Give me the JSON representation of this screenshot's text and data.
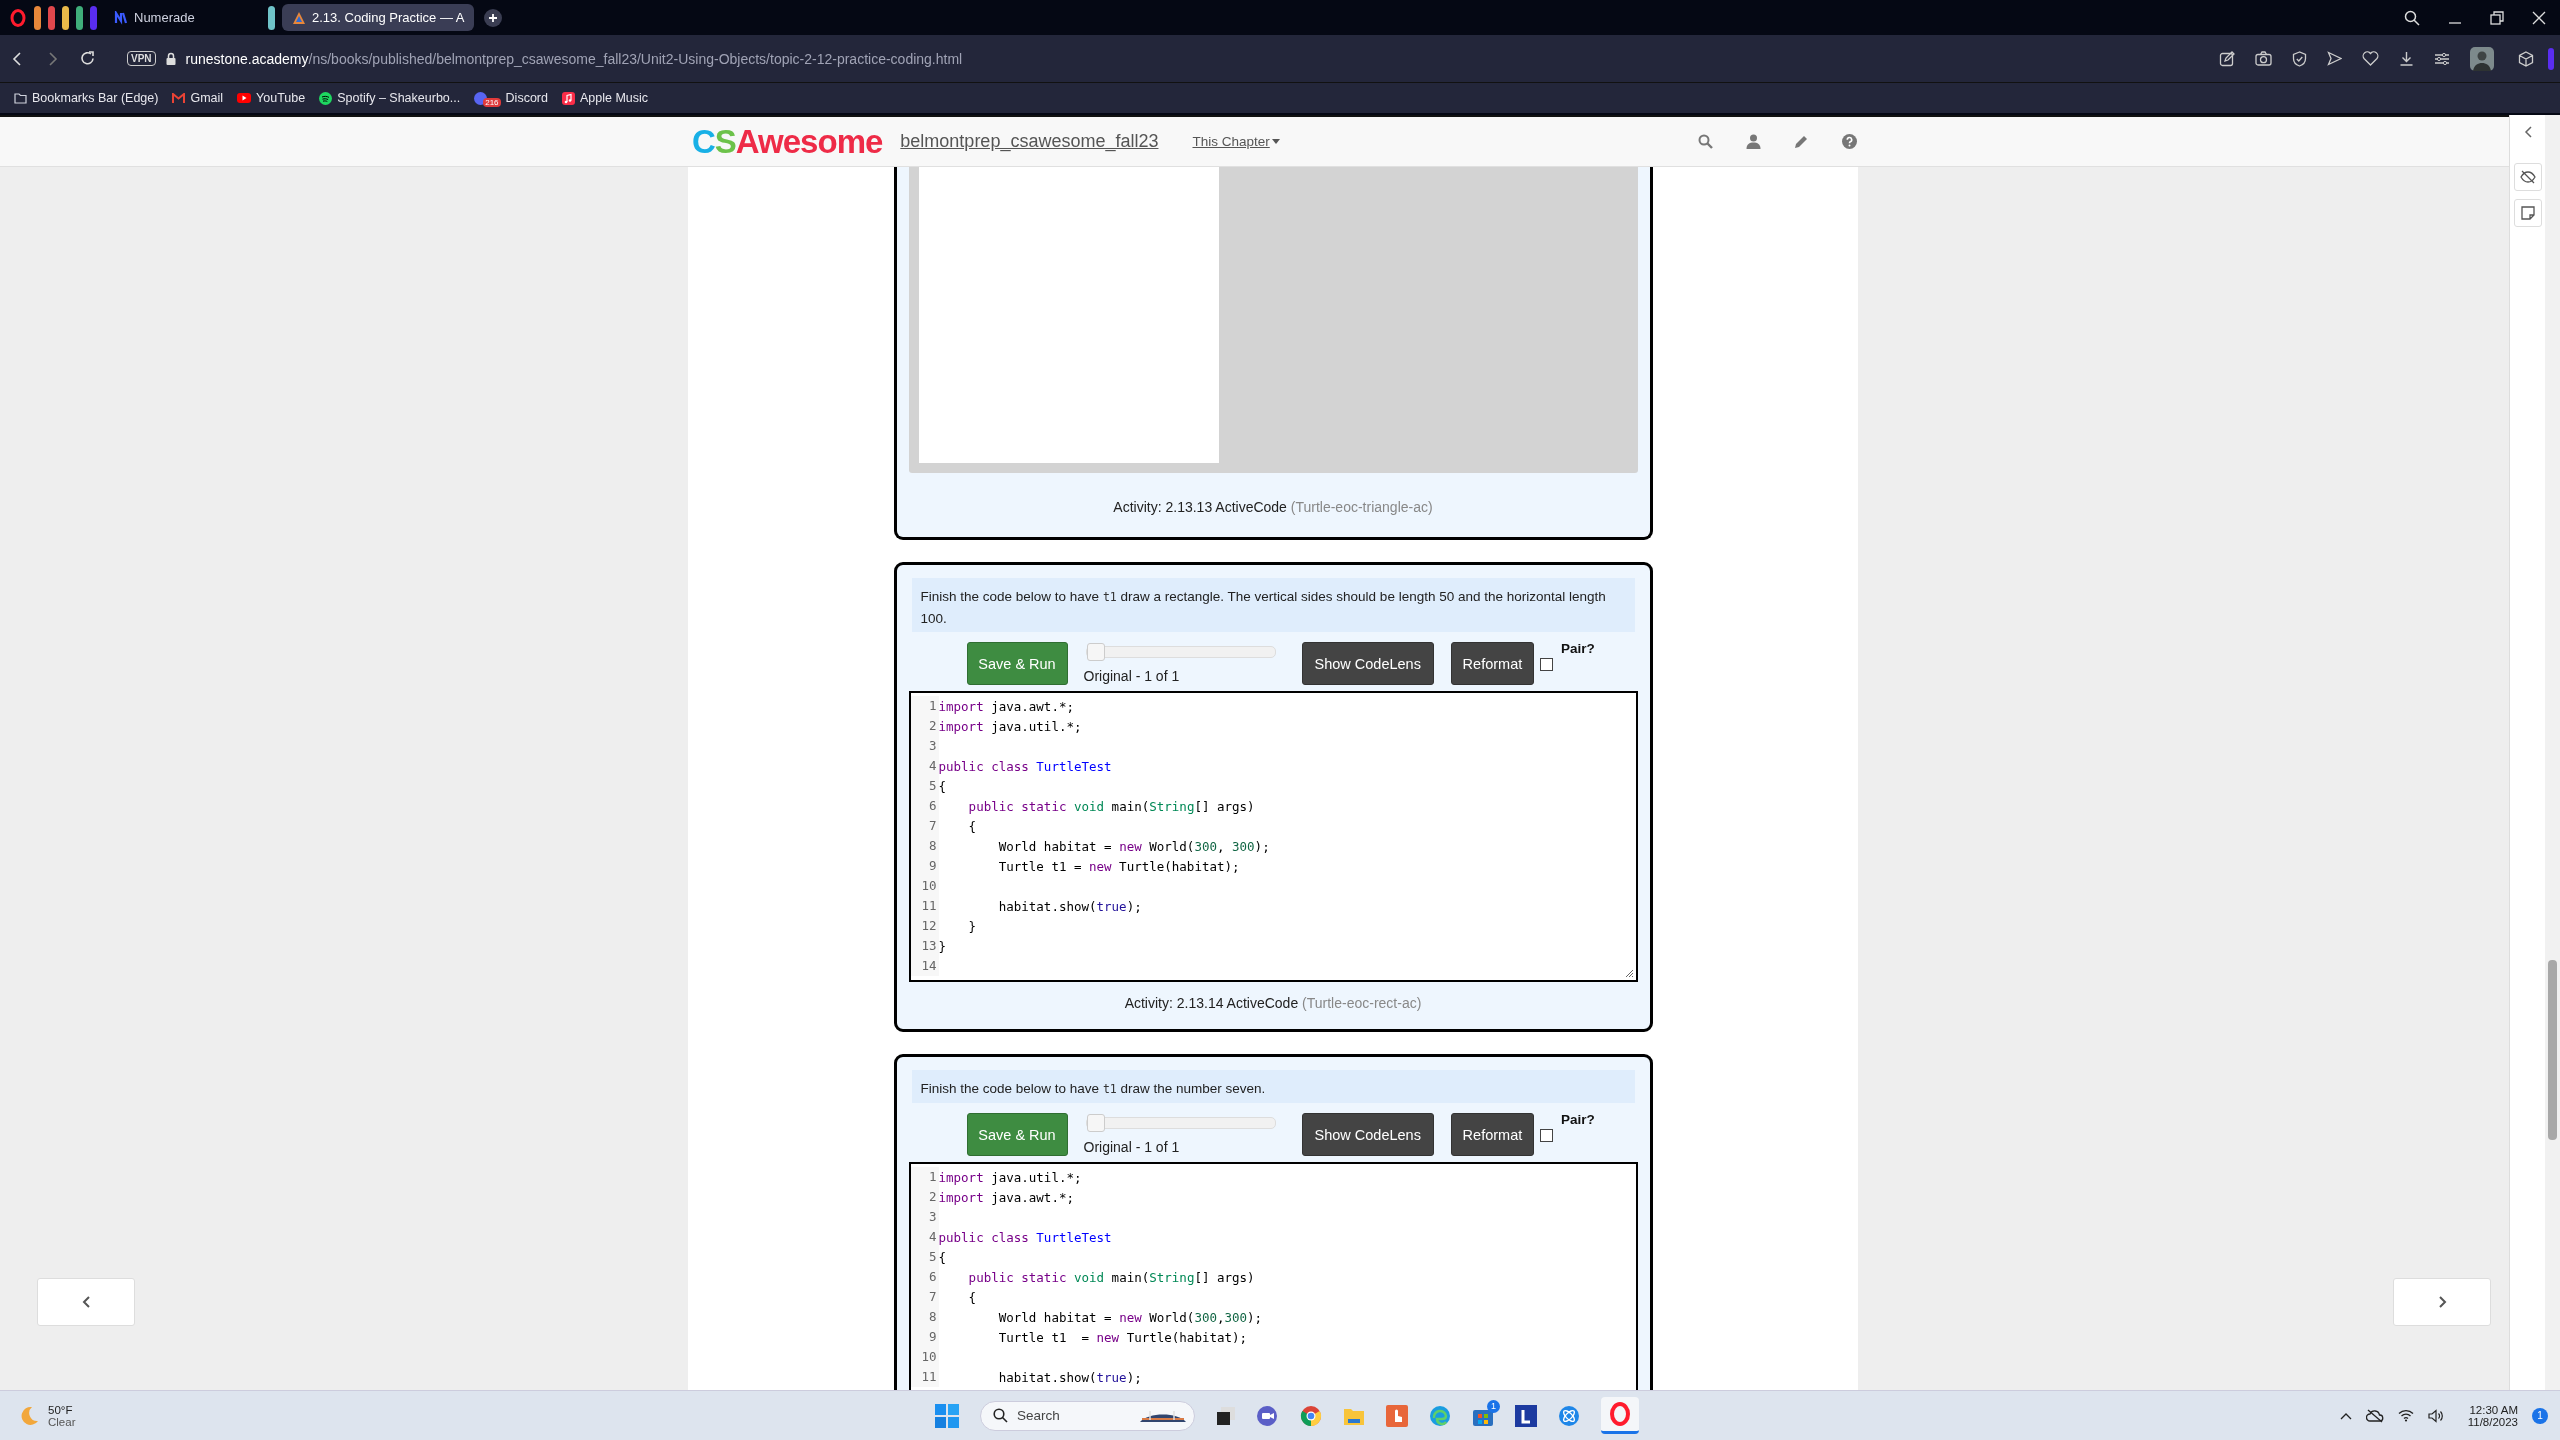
{
  "browser": {
    "workspaces": [
      {
        "color": "#e8873a"
      },
      {
        "color": "#e0474c"
      },
      {
        "color": "#e9b949"
      },
      {
        "color": "#3fae7a"
      },
      {
        "color": "#5a2df0"
      }
    ],
    "tab_pin": {
      "color": "#6fc3c9"
    },
    "tabs": [
      {
        "label": "Numerade",
        "selected": false
      },
      {
        "label": "2.13. Coding Practice — A",
        "selected": true
      }
    ],
    "address_bar": {
      "vpn": "VPN",
      "domain": "runestone.academy",
      "path": "/ns/books/published/belmontprep_csawesome_fall23/Unit2-Using-Objects/topic-2-12-practice-coding.html"
    },
    "bookmarks": [
      {
        "label": "Bookmarks Bar (Edge)",
        "kind": "folder"
      },
      {
        "label": "Gmail",
        "kind": "gmail"
      },
      {
        "label": "YouTube",
        "kind": "youtube"
      },
      {
        "label": "Spotify – Shakeurbo...",
        "kind": "spotify"
      },
      {
        "label": "Discord",
        "kind": "discord",
        "badge": "216"
      },
      {
        "label": "Apple Music",
        "kind": "music"
      }
    ]
  },
  "site_header": {
    "logo": "CSAwesome",
    "course_link": "belmontprep_csawesome_fall23",
    "chapter_menu": "This Chapter"
  },
  "activities": [
    {
      "kind": "output",
      "caption": "Activity: 2.13.13 ActiveCode",
      "caption_id": "(Turtle-eoc-triangle-ac)"
    },
    {
      "kind": "code",
      "prompt_before": "Finish the code below to have ",
      "prompt_code": "t1",
      "prompt_after": " draw a rectangle. The vertical sides should be length 50 and the horizontal length 100.",
      "run_button": "Save & Run",
      "history_slider": {
        "level": 0
      },
      "history_label": "Original - 1 of 1",
      "codelens_button": "Show CodeLens",
      "reformat_button": "Reformat",
      "pair_label": "Pair?",
      "pair_checked": false,
      "lines": [
        {
          "number": "1",
          "tokens": [
            {
              "text": "import",
              "kind": "keyword"
            },
            {
              "text": " java.awt.*;",
              "kind": "text"
            }
          ]
        },
        {
          "number": "2",
          "tokens": [
            {
              "text": "import",
              "kind": "keyword"
            },
            {
              "text": " java.util.*;",
              "kind": "text"
            }
          ]
        },
        {
          "number": "3"
        },
        {
          "number": "4",
          "tokens": [
            {
              "text": "public",
              "kind": "keyword"
            },
            {
              "text": " class",
              "kind": "keyword"
            },
            {
              "text": " TurtleTest",
              "kind": "def"
            }
          ]
        },
        {
          "number": "5",
          "tokens": [
            {
              "text": "{",
              "kind": "text"
            }
          ]
        },
        {
          "number": "6",
          "tokens": [
            {
              "text": "    public",
              "kind": "keyword"
            },
            {
              "text": " static",
              "kind": "keyword"
            },
            {
              "text": " void",
              "kind": "type"
            },
            {
              "text": " main(",
              "kind": "text"
            },
            {
              "text": "String",
              "kind": "type"
            },
            {
              "text": "[] args)",
              "kind": "text"
            }
          ]
        },
        {
          "number": "7",
          "tokens": [
            {
              "text": "    {",
              "kind": "text"
            }
          ]
        },
        {
          "number": "8",
          "tokens": [
            {
              "text": "        World habitat = ",
              "kind": "text"
            },
            {
              "text": "new",
              "kind": "keyword"
            },
            {
              "text": " World(",
              "kind": "text"
            },
            {
              "text": "300",
              "kind": "number"
            },
            {
              "text": ", ",
              "kind": "text"
            },
            {
              "text": "300",
              "kind": "number"
            },
            {
              "text": ");",
              "kind": "text"
            }
          ]
        },
        {
          "number": "9",
          "tokens": [
            {
              "text": "        Turtle t1 = ",
              "kind": "text"
            },
            {
              "text": "new",
              "kind": "keyword"
            },
            {
              "text": " Turtle(habitat);",
              "kind": "text"
            }
          ]
        },
        {
          "number": "10"
        },
        {
          "number": "11",
          "tokens": [
            {
              "text": "        habitat.show(",
              "kind": "text"
            },
            {
              "text": "true",
              "kind": "atom"
            },
            {
              "text": ");",
              "kind": "text"
            }
          ]
        },
        {
          "number": "12",
          "tokens": [
            {
              "text": "    }",
              "kind": "text"
            }
          ]
        },
        {
          "number": "13",
          "tokens": [
            {
              "text": "}",
              "kind": "text"
            }
          ]
        },
        {
          "number": "14"
        }
      ],
      "caption": "Activity: 2.13.14 ActiveCode",
      "caption_id": "(Turtle-eoc-rect-ac)"
    },
    {
      "kind": "code",
      "prompt_before": "Finish the code below to have ",
      "prompt_code": "t1",
      "prompt_after": " draw the number seven.",
      "run_button": "Save & Run",
      "history_slider": {
        "level": 0
      },
      "history_label": "Original - 1 of 1",
      "codelens_button": "Show CodeLens",
      "reformat_button": "Reformat",
      "pair_label": "Pair?",
      "pair_checked": false,
      "lines": [
        {
          "number": "1",
          "tokens": [
            {
              "text": "import",
              "kind": "keyword"
            },
            {
              "text": " java.util.*;",
              "kind": "text"
            }
          ]
        },
        {
          "number": "2",
          "tokens": [
            {
              "text": "import",
              "kind": "keyword"
            },
            {
              "text": " java.awt.*;",
              "kind": "text"
            }
          ]
        },
        {
          "number": "3"
        },
        {
          "number": "4",
          "tokens": [
            {
              "text": "public",
              "kind": "keyword"
            },
            {
              "text": " class",
              "kind": "keyword"
            },
            {
              "text": " TurtleTest",
              "kind": "def"
            }
          ]
        },
        {
          "number": "5",
          "tokens": [
            {
              "text": "{",
              "kind": "text"
            }
          ]
        },
        {
          "number": "6",
          "tokens": [
            {
              "text": "    public",
              "kind": "keyword"
            },
            {
              "text": " static",
              "kind": "keyword"
            },
            {
              "text": " void",
              "kind": "type"
            },
            {
              "text": " main(",
              "kind": "text"
            },
            {
              "text": "String",
              "kind": "type"
            },
            {
              "text": "[] args)",
              "kind": "text"
            }
          ]
        },
        {
          "number": "7",
          "tokens": [
            {
              "text": "    {",
              "kind": "text"
            }
          ]
        },
        {
          "number": "8",
          "tokens": [
            {
              "text": "        World habitat = ",
              "kind": "text"
            },
            {
              "text": "new",
              "kind": "keyword"
            },
            {
              "text": " World(",
              "kind": "text"
            },
            {
              "text": "300",
              "kind": "number"
            },
            {
              "text": ",",
              "kind": "text"
            },
            {
              "text": "300",
              "kind": "number"
            },
            {
              "text": ");",
              "kind": "text"
            }
          ]
        },
        {
          "number": "9",
          "tokens": [
            {
              "text": "        Turtle t1  = ",
              "kind": "text"
            },
            {
              "text": "new",
              "kind": "keyword"
            },
            {
              "text": " Turtle(habitat);",
              "kind": "text"
            }
          ]
        },
        {
          "number": "10"
        },
        {
          "number": "11",
          "tokens": [
            {
              "text": "        habitat.show(",
              "kind": "text"
            },
            {
              "text": "true",
              "kind": "atom"
            },
            {
              "text": ");",
              "kind": "text"
            }
          ]
        }
      ]
    }
  ],
  "taskbar": {
    "temperature": "50°F",
    "condition": "Clear",
    "search_placeholder": "Search",
    "store_badge": "1",
    "time": "12:30 AM",
    "date": "11/8/2023",
    "notification_count": "1"
  }
}
